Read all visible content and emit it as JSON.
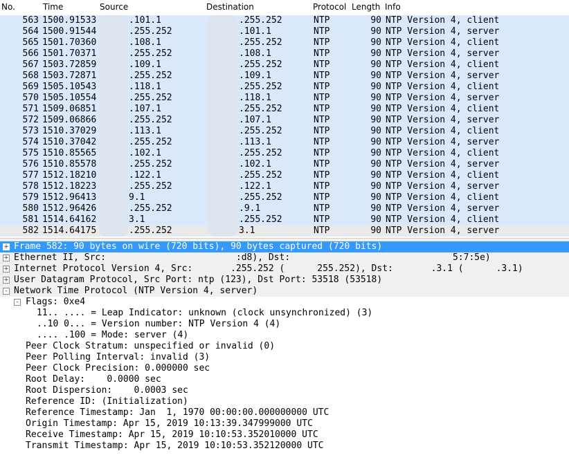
{
  "columns": {
    "no": "No.",
    "time": "Time",
    "source": "Source",
    "destination": "Destination",
    "protocol": "Protocol",
    "length": "Length",
    "info": "Info"
  },
  "packets": [
    {
      "no": "563",
      "time": "1500.91533",
      "src": ".101.1",
      "dst": ".255.252",
      "proto": "NTP",
      "len": "90",
      "info": "NTP Version 4, client"
    },
    {
      "no": "564",
      "time": "1500.91544",
      "src": ".255.252",
      "dst": ".101.1",
      "proto": "NTP",
      "len": "90",
      "info": "NTP Version 4, server"
    },
    {
      "no": "565",
      "time": "1501.70360",
      "src": ".108.1",
      "dst": ".255.252",
      "proto": "NTP",
      "len": "90",
      "info": "NTP Version 4, client"
    },
    {
      "no": "566",
      "time": "1501.70371",
      "src": ".255.252",
      "dst": ".108.1",
      "proto": "NTP",
      "len": "90",
      "info": "NTP Version 4, server"
    },
    {
      "no": "567",
      "time": "1503.72859",
      "src": ".109.1",
      "dst": ".255.252",
      "proto": "NTP",
      "len": "90",
      "info": "NTP Version 4, client"
    },
    {
      "no": "568",
      "time": "1503.72871",
      "src": ".255.252",
      "dst": ".109.1",
      "proto": "NTP",
      "len": "90",
      "info": "NTP Version 4, server"
    },
    {
      "no": "569",
      "time": "1505.10543",
      "src": ".118.1",
      "dst": ".255.252",
      "proto": "NTP",
      "len": "90",
      "info": "NTP Version 4, client"
    },
    {
      "no": "570",
      "time": "1505.10554",
      "src": ".255.252",
      "dst": ".118.1",
      "proto": "NTP",
      "len": "90",
      "info": "NTP Version 4, server"
    },
    {
      "no": "571",
      "time": "1509.06851",
      "src": ".107.1",
      "dst": ".255.252",
      "proto": "NTP",
      "len": "90",
      "info": "NTP Version 4, client"
    },
    {
      "no": "572",
      "time": "1509.06866",
      "src": ".255.252",
      "dst": ".107.1",
      "proto": "NTP",
      "len": "90",
      "info": "NTP Version 4, server"
    },
    {
      "no": "573",
      "time": "1510.37029",
      "src": ".113.1",
      "dst": ".255.252",
      "proto": "NTP",
      "len": "90",
      "info": "NTP Version 4, client"
    },
    {
      "no": "574",
      "time": "1510.37042",
      "src": ".255.252",
      "dst": ".113.1",
      "proto": "NTP",
      "len": "90",
      "info": "NTP Version 4, server"
    },
    {
      "no": "575",
      "time": "1510.85565",
      "src": ".102.1",
      "dst": ".255.252",
      "proto": "NTP",
      "len": "90",
      "info": "NTP Version 4, client"
    },
    {
      "no": "576",
      "time": "1510.85578",
      "src": ".255.252",
      "dst": ".102.1",
      "proto": "NTP",
      "len": "90",
      "info": "NTP Version 4, server"
    },
    {
      "no": "577",
      "time": "1512.18210",
      "src": ".122.1",
      "dst": ".255.252",
      "proto": "NTP",
      "len": "90",
      "info": "NTP Version 4, client"
    },
    {
      "no": "578",
      "time": "1512.18223",
      "src": ".255.252",
      "dst": ".122.1",
      "proto": "NTP",
      "len": "90",
      "info": "NTP Version 4, server"
    },
    {
      "no": "579",
      "time": "1512.96413",
      "src": "9.1",
      "dst": ".255.252",
      "proto": "NTP",
      "len": "90",
      "info": "NTP Version 4, client"
    },
    {
      "no": "580",
      "time": "1512.96426",
      "src": ".255.252",
      "dst": ".9.1",
      "proto": "NTP",
      "len": "90",
      "info": "NTP Version 4, server"
    },
    {
      "no": "581",
      "time": "1514.64162",
      "src": "3.1",
      "dst": ".255.252",
      "proto": "NTP",
      "len": "90",
      "info": "NTP Version 4, client"
    },
    {
      "no": "582",
      "time": "1514.64175",
      "src": ".255.252",
      "dst": "3.1",
      "proto": "NTP",
      "len": "90",
      "info": "NTP Version 4, server"
    }
  ],
  "details": [
    {
      "text": "Frame 582: 90 bytes on wire (720 bits), 90 bytes captured (720 bits)",
      "expander": "+",
      "selected": true,
      "indent": 0
    },
    {
      "text": "Ethernet II, Src:                        :d8), Dst:                              5:7:5e)",
      "expander": "+",
      "indent": 0
    },
    {
      "text": "Internet Protocol Version 4, Src:       .255.252 (      255.252), Dst:       .3.1 (      .3.1)",
      "expander": "+",
      "indent": 0
    },
    {
      "text": "User Datagram Protocol, Src Port: ntp (123), Dst Port: 53518 (53518)",
      "expander": "+",
      "indent": 0
    },
    {
      "text": "Network Time Protocol (NTP Version 4, server)",
      "expander": "-",
      "indent": 0
    },
    {
      "text": "Flags: 0xe4",
      "expander": "-",
      "indent": 1
    },
    {
      "text": "11.. .... = Leap Indicator: unknown (clock unsynchronized) (3)",
      "indent": 2
    },
    {
      "text": "..10 0... = Version number: NTP Version 4 (4)",
      "indent": 2
    },
    {
      "text": ".... .100 = Mode: server (4)",
      "indent": 2
    },
    {
      "text": "Peer Clock Stratum: unspecified or invalid (0)",
      "indent": 1
    },
    {
      "text": "Peer Polling Interval: invalid (3)",
      "indent": 1
    },
    {
      "text": "Peer Clock Precision: 0.000000 sec",
      "indent": 1
    },
    {
      "text": "Root Delay:    0.0000 sec",
      "indent": 1
    },
    {
      "text": "Root Dispersion:    0.0003 sec",
      "indent": 1
    },
    {
      "text": "Reference ID: (Initialization)",
      "indent": 1
    },
    {
      "text": "Reference Timestamp: Jan  1, 1970 00:00:00.000000000 UTC",
      "indent": 1
    },
    {
      "text": "Origin Timestamp: Apr 15, 2019 10:13:39.347999000 UTC",
      "indent": 1
    },
    {
      "text": "Receive Timestamp: Apr 15, 2019 10:10:53.352010000 UTC",
      "indent": 1
    },
    {
      "text": "Transmit Timestamp: Apr 15, 2019 10:10:53.352120000 UTC",
      "indent": 1
    }
  ]
}
